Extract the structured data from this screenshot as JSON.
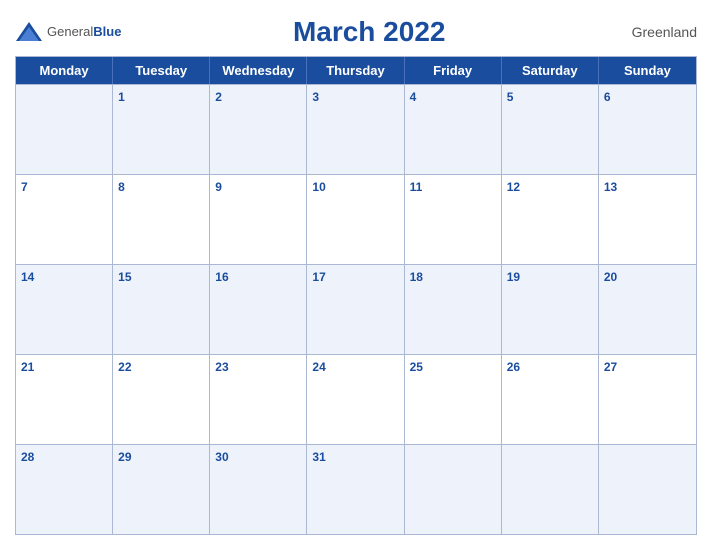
{
  "header": {
    "logo_general": "General",
    "logo_blue": "Blue",
    "title": "March 2022",
    "region": "Greenland"
  },
  "dayHeaders": [
    "Monday",
    "Tuesday",
    "Wednesday",
    "Thursday",
    "Friday",
    "Saturday",
    "Sunday"
  ],
  "weeks": [
    [
      {
        "date": "",
        "empty": true
      },
      {
        "date": "1"
      },
      {
        "date": "2"
      },
      {
        "date": "3"
      },
      {
        "date": "4"
      },
      {
        "date": "5"
      },
      {
        "date": "6"
      }
    ],
    [
      {
        "date": "7"
      },
      {
        "date": "8"
      },
      {
        "date": "9"
      },
      {
        "date": "10"
      },
      {
        "date": "11"
      },
      {
        "date": "12"
      },
      {
        "date": "13"
      }
    ],
    [
      {
        "date": "14"
      },
      {
        "date": "15"
      },
      {
        "date": "16"
      },
      {
        "date": "17"
      },
      {
        "date": "18"
      },
      {
        "date": "19"
      },
      {
        "date": "20"
      }
    ],
    [
      {
        "date": "21"
      },
      {
        "date": "22"
      },
      {
        "date": "23"
      },
      {
        "date": "24"
      },
      {
        "date": "25"
      },
      {
        "date": "26"
      },
      {
        "date": "27"
      }
    ],
    [
      {
        "date": "28"
      },
      {
        "date": "29"
      },
      {
        "date": "30"
      },
      {
        "date": "31"
      },
      {
        "date": "",
        "empty": true
      },
      {
        "date": "",
        "empty": true
      },
      {
        "date": "",
        "empty": true
      }
    ]
  ]
}
